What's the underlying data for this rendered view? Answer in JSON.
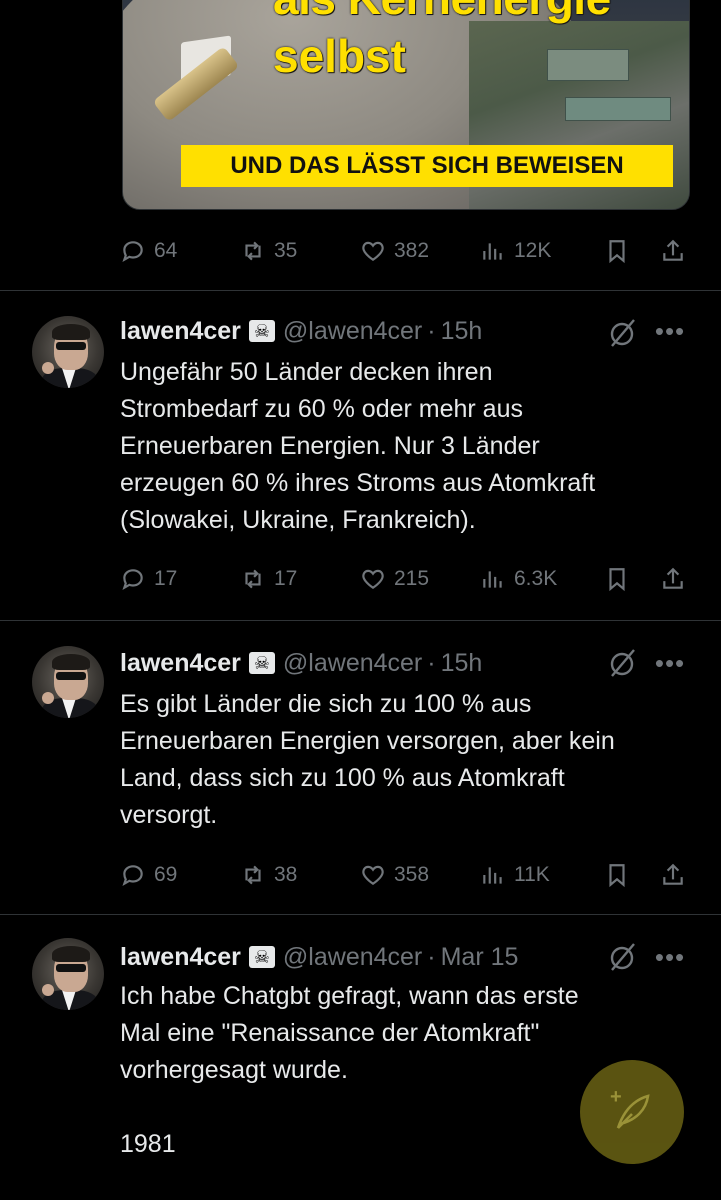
{
  "media": {
    "headline_line1": "als Kernenergie",
    "headline_line2": "selbst",
    "banner": "UND DAS LÄSST SICH BEWEISEN"
  },
  "top_actions": {
    "replies": "64",
    "retweets": "35",
    "likes": "382",
    "views": "12K"
  },
  "tweets": [
    {
      "name": "lawen4cer",
      "badge": "☠",
      "handle": "@lawen4cer",
      "dot": "·",
      "time": "15h",
      "text": "Ungefähr 50 Länder decken ihren\nStrombedarf zu 60 % oder mehr aus\nErneuerbaren Energien. Nur 3 Länder\nerzeugen 60 % ihres Stroms aus Atomkraft\n(Slowakei, Ukraine, Frankreich).",
      "replies": "17",
      "retweets": "17",
      "likes": "215",
      "views": "6.3K"
    },
    {
      "name": "lawen4cer",
      "badge": "☠",
      "handle": "@lawen4cer",
      "dot": "·",
      "time": "15h",
      "text": "Es gibt Länder die sich zu 100 % aus\nErneuerbaren Energien versorgen, aber kein\nLand, dass sich zu 100 % aus Atomkraft\nversorgt.",
      "replies": "69",
      "retweets": "38",
      "likes": "358",
      "views": "11K"
    },
    {
      "name": "lawen4cer",
      "badge": "☠",
      "handle": "@lawen4cer",
      "dot": "·",
      "time": "Mar 15",
      "text": "Ich habe Chatgbt gefragt, wann das erste\nMal eine \"Renaissance der Atomkraft\"\nvorhergesagt wurde.\n\n1981"
    }
  ],
  "more_label": "•••"
}
